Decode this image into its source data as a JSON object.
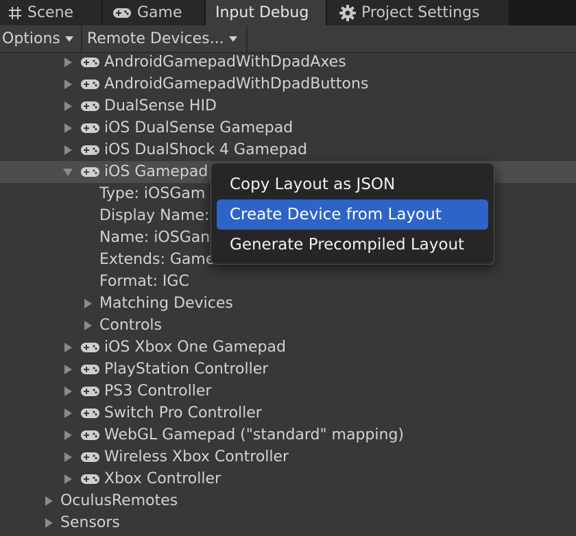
{
  "tabs": [
    {
      "label": "Scene",
      "icon": "grid-icon",
      "active": false
    },
    {
      "label": "Game",
      "icon": "gamepad-icon",
      "active": false
    },
    {
      "label": "Input Debug",
      "icon": "",
      "active": true
    },
    {
      "label": "Project Settings",
      "icon": "gear-icon",
      "active": false
    }
  ],
  "toolbar": {
    "options_label": "Options",
    "remote_devices_label": "Remote Devices..."
  },
  "tree": {
    "devices_before": [
      "AndroidGamepadWithDpadAxes",
      "AndroidGamepadWithDpadButtons",
      "DualSense HID",
      "iOS DualSense Gamepad",
      "iOS DualShock 4 Gamepad"
    ],
    "expanded_device": {
      "label": "iOS Gamepad",
      "details": [
        "Type: iOSGam",
        "Display Name:",
        "Name: iOSGan",
        "Extends: Game",
        "Format: IGC"
      ],
      "subgroups": [
        "Matching Devices",
        "Controls"
      ]
    },
    "devices_after": [
      "iOS Xbox One Gamepad",
      "PlayStation Controller",
      "PS3 Controller",
      "Switch Pro Controller",
      "WebGL Gamepad (\"standard\" mapping)",
      "Wireless Xbox Controller",
      "Xbox Controller"
    ],
    "groups": [
      "OculusRemotes",
      "Sensors"
    ]
  },
  "context_menu": {
    "items": [
      "Copy Layout as JSON",
      "Create Device from Layout",
      "Generate Precompiled Layout"
    ],
    "highlighted_index": 1,
    "highlight_color": "#2e63c8"
  },
  "colors": {
    "background": "#383838",
    "text": "#d2d2d2",
    "tabbar": "#191919",
    "selected_row": "#4d4d4d"
  }
}
